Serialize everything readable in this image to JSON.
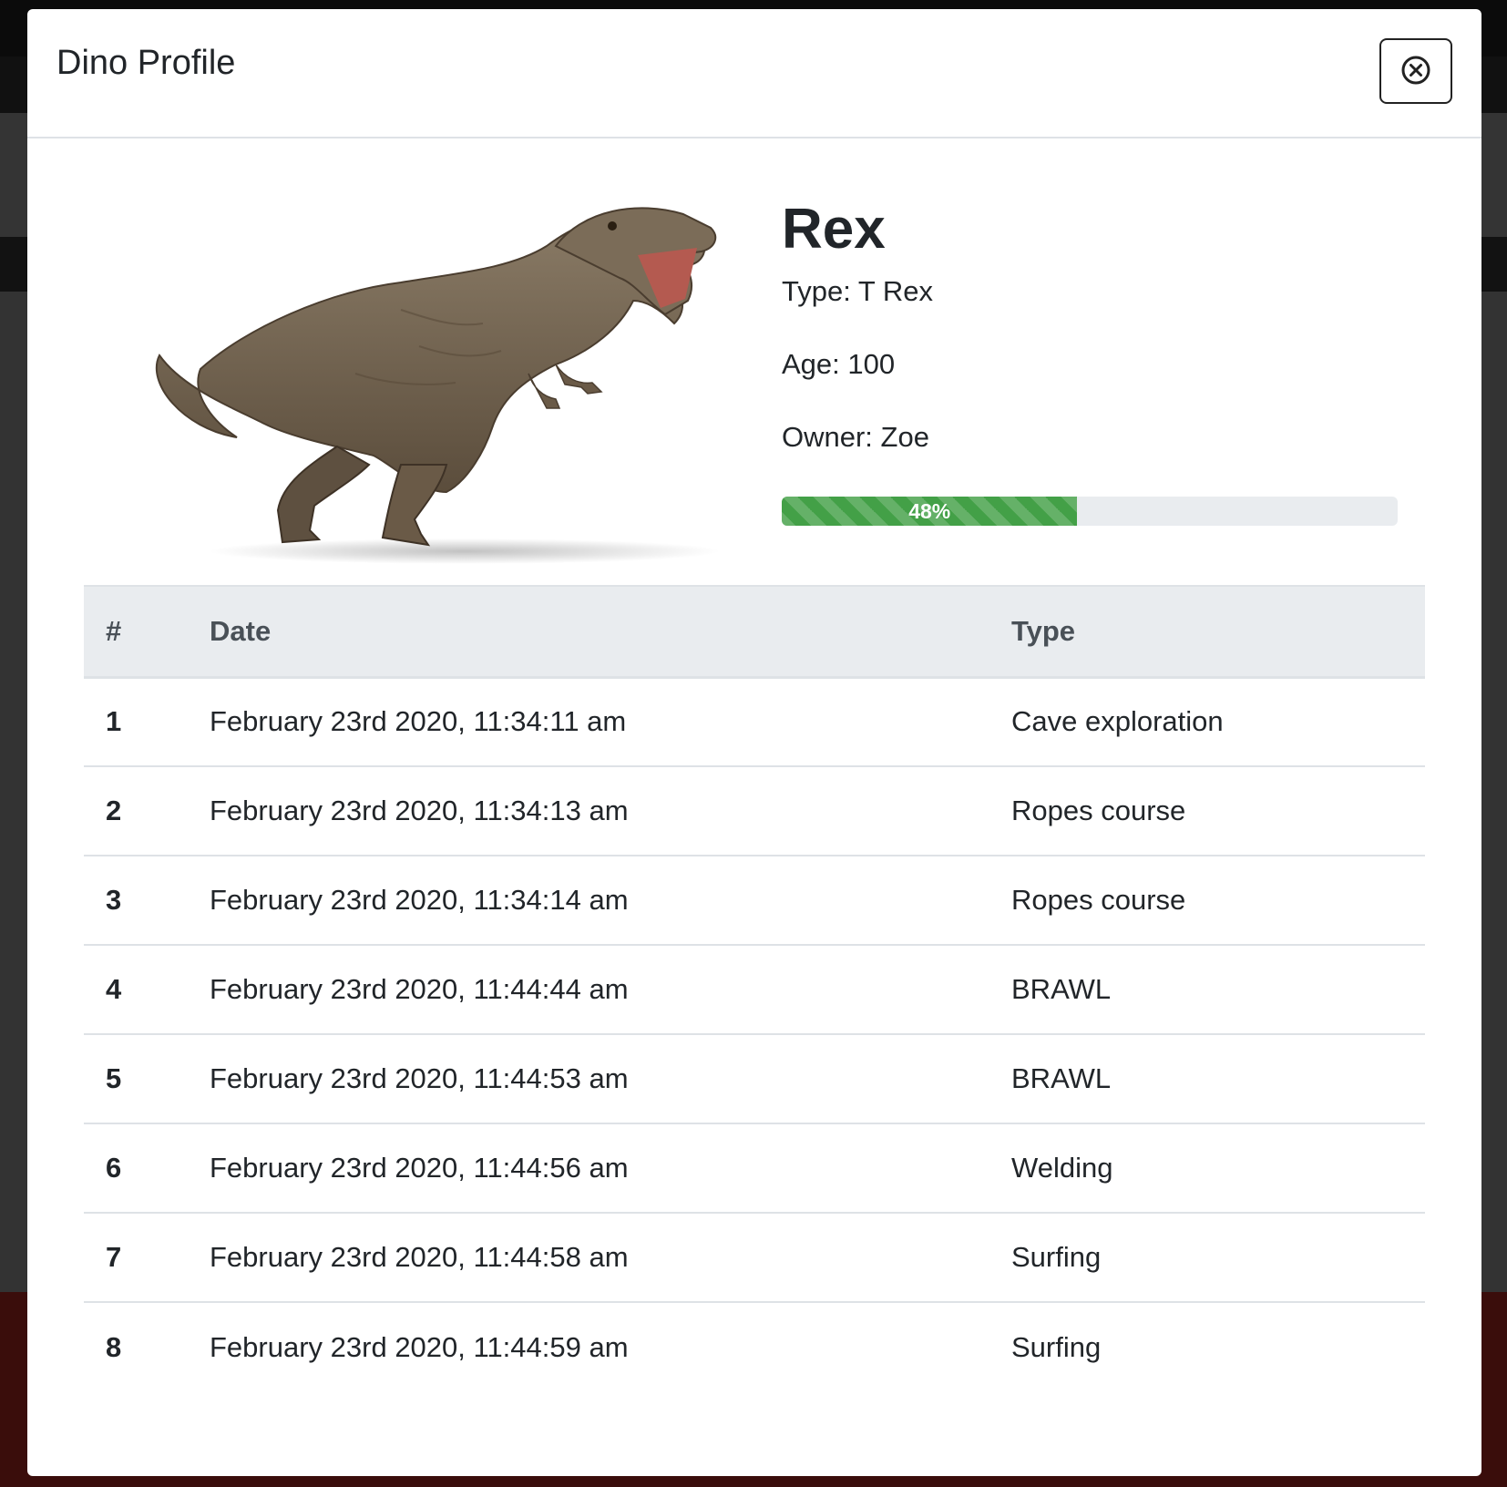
{
  "modal": {
    "title": "Dino Profile",
    "close_icon": "close-circle-icon"
  },
  "dino": {
    "name": "Rex",
    "type_line": "Type: T Rex",
    "age_line": "Age: 100",
    "owner_line": "Owner: Zoe",
    "progress_percent": 48,
    "progress_label": "48%",
    "progress_color": "#43a047"
  },
  "table": {
    "headers": [
      "#",
      "Date",
      "Type"
    ],
    "rows": [
      {
        "num": "1",
        "date": "February 23rd 2020, 11:34:11 am",
        "type": "Cave exploration"
      },
      {
        "num": "2",
        "date": "February 23rd 2020, 11:34:13 am",
        "type": "Ropes course"
      },
      {
        "num": "3",
        "date": "February 23rd 2020, 11:34:14 am",
        "type": "Ropes course"
      },
      {
        "num": "4",
        "date": "February 23rd 2020, 11:44:44 am",
        "type": "BRAWL"
      },
      {
        "num": "5",
        "date": "February 23rd 2020, 11:44:53 am",
        "type": "BRAWL"
      },
      {
        "num": "6",
        "date": "February 23rd 2020, 11:44:56 am",
        "type": "Welding"
      },
      {
        "num": "7",
        "date": "February 23rd 2020, 11:44:58 am",
        "type": "Surfing"
      },
      {
        "num": "8",
        "date": "February 23rd 2020, 11:44:59 am",
        "type": "Surfing"
      }
    ]
  }
}
